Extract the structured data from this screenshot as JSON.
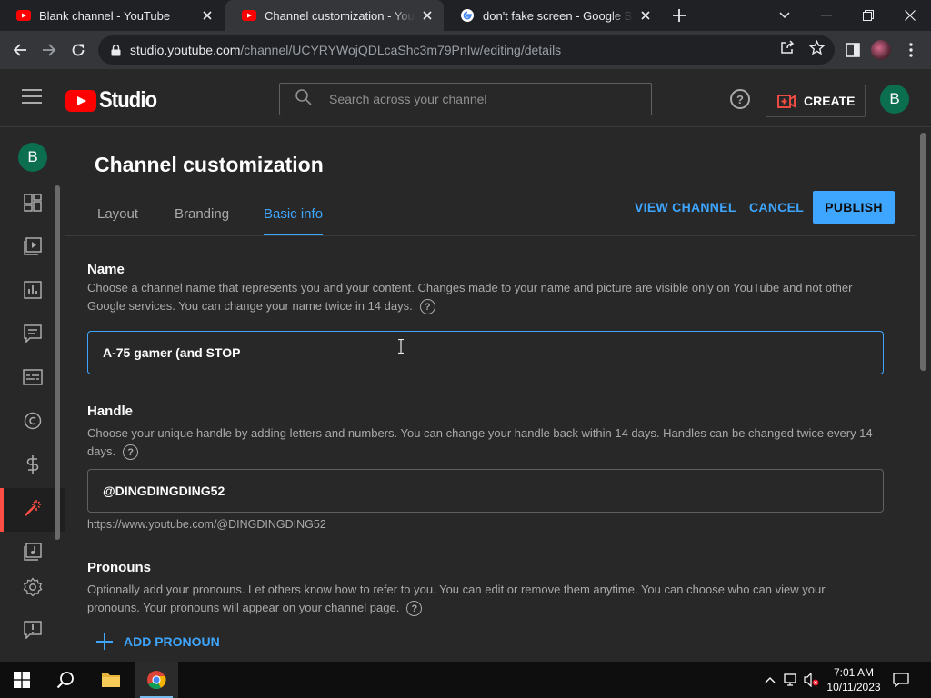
{
  "browser": {
    "tabs": [
      {
        "title": "Blank channel - YouTube",
        "favicon": "youtube-icon"
      },
      {
        "title": "Channel customization - YouTube Studio",
        "favicon": "youtube-icon",
        "active": true
      },
      {
        "title": "don't fake screen - Google Search",
        "favicon": "google-icon"
      }
    ],
    "url_host": "studio.youtube.com",
    "url_path": "/channel/UCYRYWojQDLcaShc3m79PnIw/editing/details"
  },
  "studio": {
    "logo_text": "Studio",
    "search_placeholder": "Search across your channel",
    "create_label": "CREATE",
    "avatar_letter": "B"
  },
  "sidebar": {
    "avatar_letter": "B",
    "items": [
      "dashboard-icon",
      "content-icon",
      "analytics-icon",
      "comments-icon",
      "subtitles-icon",
      "copyright-icon",
      "earn-icon",
      "customization-icon",
      "audio-library-icon",
      "settings-icon",
      "feedback-icon"
    ],
    "active_item": "customization-icon"
  },
  "page": {
    "title": "Channel customization",
    "tabs": [
      "Layout",
      "Branding",
      "Basic info"
    ],
    "active_tab": "Basic info",
    "view_channel": "VIEW CHANNEL",
    "cancel": "CANCEL",
    "publish": "PUBLISH"
  },
  "name_section": {
    "title": "Name",
    "description": "Choose a channel name that represents you and your content. Changes made to your name and picture are visible only on YouTube and not other Google services. You can change your name twice in 14 days.",
    "value": "A-75 gamer (and STOP"
  },
  "handle_section": {
    "title": "Handle",
    "description": "Choose your unique handle by adding letters and numbers. You can change your handle back within 14 days. Handles can be changed twice every 14 days.",
    "value": "@DINGDINGDING52",
    "url": "https://www.youtube.com/@DINGDINGDING52"
  },
  "pronouns_section": {
    "title": "Pronouns",
    "description": "Optionally add your pronouns. Let others know how to refer to you. You can edit or remove them anytime. You can choose who can view your pronouns. Your pronouns will appear on your channel page.",
    "add_label": "ADD PRONOUN"
  },
  "taskbar": {
    "time": "7:01 AM",
    "date": "10/11/2023"
  },
  "colors": {
    "accent": "#3ea6ff",
    "brand_red": "#ff0000",
    "avatar_green": "#0b6e4f"
  }
}
